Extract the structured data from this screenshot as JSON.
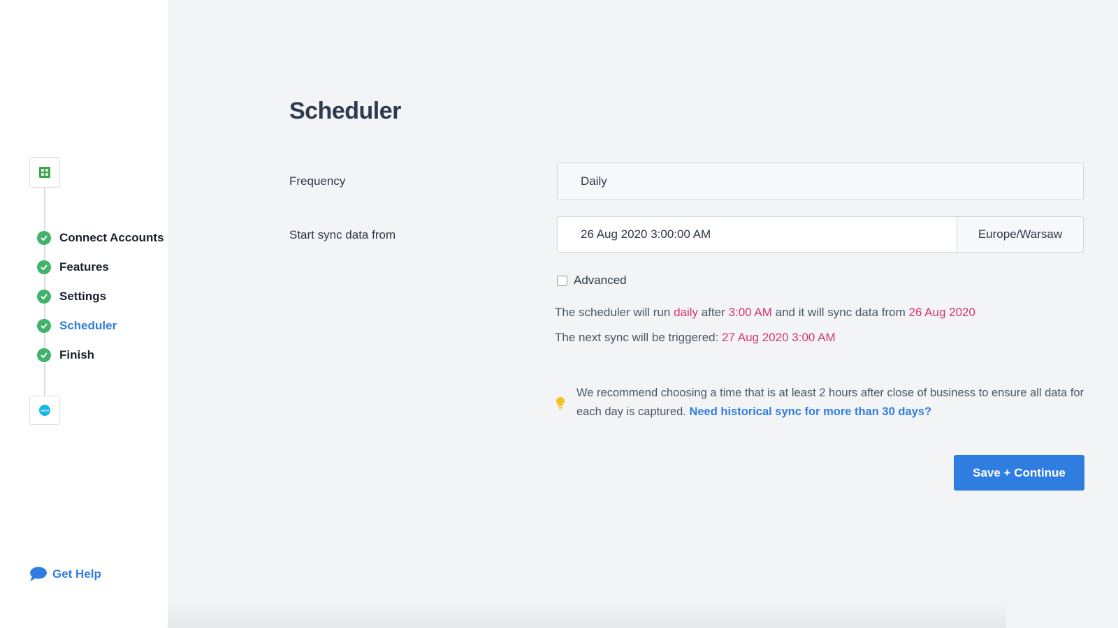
{
  "sidebar": {
    "top_app_icon": "spreadsheet-app-icon",
    "bottom_app_icon": "xero-icon",
    "bottom_app_text": "xero",
    "steps": [
      {
        "label": "Connect Accounts",
        "status": "complete"
      },
      {
        "label": "Features",
        "status": "complete"
      },
      {
        "label": "Settings",
        "status": "complete"
      },
      {
        "label": "Scheduler",
        "status": "complete",
        "active": true
      },
      {
        "label": "Finish",
        "status": "complete"
      }
    ],
    "help_label": "Get Help"
  },
  "main": {
    "title": "Scheduler",
    "frequency": {
      "label": "Frequency",
      "value": "Daily"
    },
    "start_sync": {
      "label": "Start sync data from",
      "date_value": "26 Aug 2020 3:00:00 AM",
      "timezone": "Europe/Warsaw"
    },
    "advanced": {
      "label": "Advanced",
      "checked": false
    },
    "summary": {
      "line1_a": "The scheduler will run ",
      "line1_freq": "daily",
      "line1_b": " after ",
      "line1_time": "3:00 AM",
      "line1_c": " and it will sync data from ",
      "line1_date": "26 Aug 2020",
      "line2_a": "The next sync will be triggered: ",
      "line2_next": "27 Aug 2020 3:00 AM"
    },
    "tip": {
      "text": "We recommend choosing a time that is at least 2 hours after close of business to ensure all data for each day is captured. ",
      "link": "Need historical sync for more than 30 days?"
    },
    "save_label": "Save + Continue"
  },
  "colors": {
    "accent": "#2f7de1",
    "highlight": "#d5336b",
    "success": "#3fb46a",
    "background": "#f3f4f6"
  }
}
